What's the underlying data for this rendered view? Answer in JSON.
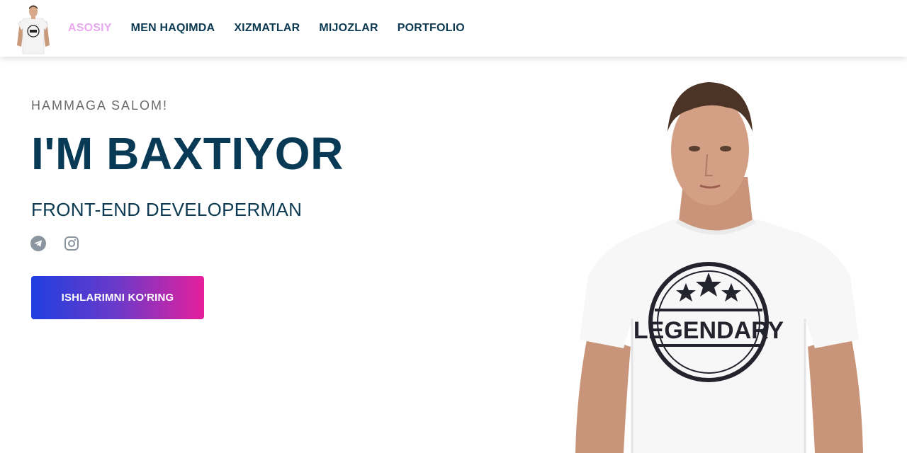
{
  "nav": {
    "logo_alt": "profile",
    "links": [
      {
        "label": "ASOSIY",
        "active": true
      },
      {
        "label": "MEN HAQIMDA"
      },
      {
        "label": "XIZMATLAR"
      },
      {
        "label": "MIJOZLAR"
      },
      {
        "label": "PORTFOLIO"
      }
    ]
  },
  "hero": {
    "greeting": "HAMMAGA SALOM!",
    "headline": "I'M BAXTIYOR",
    "role": "FRONT-END DEVELOPERMAN",
    "cta_label": "ISHLARIMNI KO'RING",
    "shirt_text": "LEGENDARY"
  },
  "socials": [
    {
      "icon": "telegram-icon"
    },
    {
      "icon": "instagram-icon"
    }
  ],
  "colors": {
    "nav_text": "#0c3a52",
    "nav_active": "#e9a8f0",
    "headline": "#083a55",
    "gradient_start": "#1f3fe0",
    "gradient_end": "#e61f9c"
  }
}
